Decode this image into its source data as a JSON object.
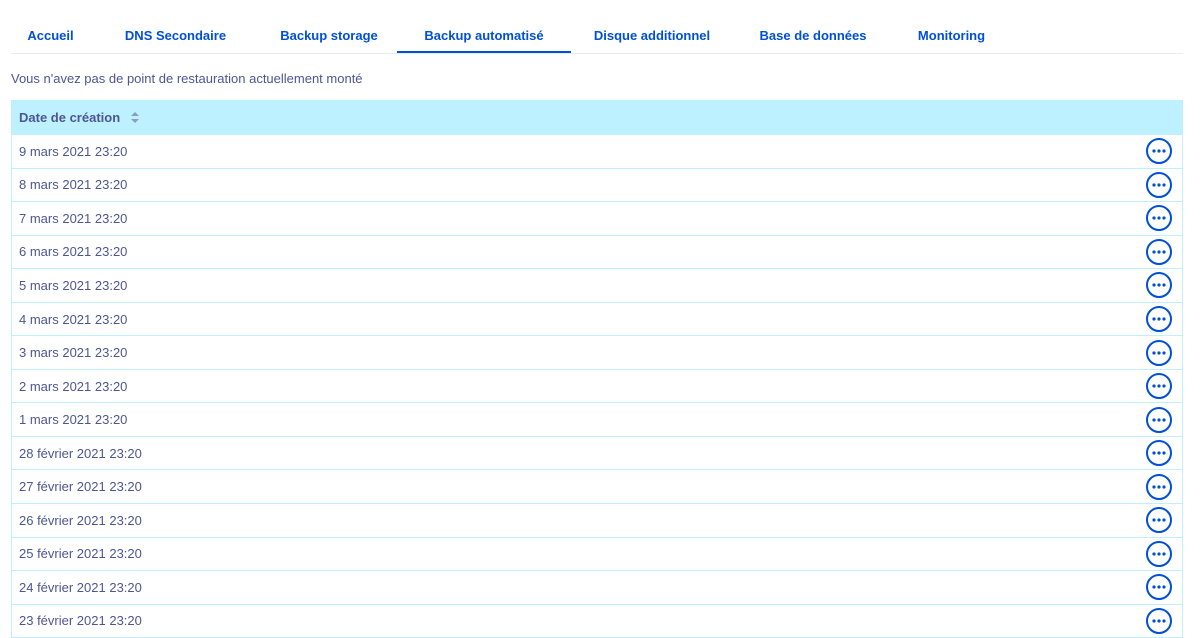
{
  "tabs": [
    {
      "label": "Accueil",
      "active": false
    },
    {
      "label": "DNS Secondaire",
      "active": false
    },
    {
      "label": "Backup storage",
      "active": false
    },
    {
      "label": "Backup automatisé",
      "active": true
    },
    {
      "label": "Disque additionnel",
      "active": false
    },
    {
      "label": "Base de données",
      "active": false
    },
    {
      "label": "Monitoring",
      "active": false
    }
  ],
  "intro_text": "Vous n'avez pas de point de restauration actuellement monté",
  "table": {
    "column_header": "Date de création",
    "rows": [
      "9 mars 2021 23:20",
      "8 mars 2021 23:20",
      "7 mars 2021 23:20",
      "6 mars 2021 23:20",
      "5 mars 2021 23:20",
      "4 mars 2021 23:20",
      "3 mars 2021 23:20",
      "2 mars 2021 23:20",
      "1 mars 2021 23:20",
      "28 février 2021 23:20",
      "27 février 2021 23:20",
      "26 février 2021 23:20",
      "25 février 2021 23:20",
      "24 février 2021 23:20",
      "23 février 2021 23:20"
    ]
  },
  "icons": {
    "sort": "sort-icon",
    "row_action": "more-horizontal-icon"
  },
  "colors": {
    "accent": "#0050d7",
    "text": "#4d5693",
    "header_bg": "#bef1ff",
    "row_border": "#bef1ff"
  }
}
